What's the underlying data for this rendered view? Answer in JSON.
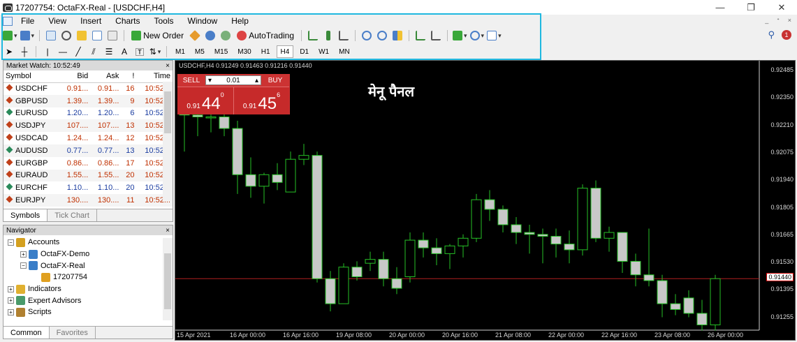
{
  "window": {
    "title": "17207754: OctaFX-Real - [USDCHF,H4]",
    "controls": [
      "—",
      "❐",
      "✕"
    ]
  },
  "menu": [
    "File",
    "View",
    "Insert",
    "Charts",
    "Tools",
    "Window",
    "Help"
  ],
  "mdi_controls": [
    "_",
    "ᐩ",
    "×"
  ],
  "toolbar": {
    "new_order": "New Order",
    "autotrading": "AutoTrading"
  },
  "timeframes": [
    "M1",
    "M5",
    "M15",
    "M30",
    "H1",
    "H4",
    "D1",
    "W1",
    "MN"
  ],
  "active_timeframe": "H4",
  "text_tool": "A",
  "market_watch": {
    "title": "Market Watch: 10:52:49",
    "close": "×",
    "columns": [
      "Symbol",
      "Bid",
      "Ask",
      "!",
      "Time"
    ],
    "rows": [
      {
        "symbol": "USDCHF",
        "bid": "0.91...",
        "ask": "0.91...",
        "spread": "16",
        "time": "10:52...",
        "dir": "down"
      },
      {
        "symbol": "GBPUSD",
        "bid": "1.39...",
        "ask": "1.39...",
        "spread": "9",
        "time": "10:52...",
        "dir": "down"
      },
      {
        "symbol": "EURUSD",
        "bid": "1.20...",
        "ask": "1.20...",
        "spread": "6",
        "time": "10:52...",
        "dir": "up"
      },
      {
        "symbol": "USDJPY",
        "bid": "107....",
        "ask": "107....",
        "spread": "13",
        "time": "10:52...",
        "dir": "down"
      },
      {
        "symbol": "USDCAD",
        "bid": "1.24...",
        "ask": "1.24...",
        "spread": "12",
        "time": "10:52...",
        "dir": "down"
      },
      {
        "symbol": "AUDUSD",
        "bid": "0.77...",
        "ask": "0.77...",
        "spread": "13",
        "time": "10:52...",
        "dir": "up"
      },
      {
        "symbol": "EURGBP",
        "bid": "0.86...",
        "ask": "0.86...",
        "spread": "17",
        "time": "10:52...",
        "dir": "down"
      },
      {
        "symbol": "EURAUD",
        "bid": "1.55...",
        "ask": "1.55...",
        "spread": "20",
        "time": "10:52...",
        "dir": "down"
      },
      {
        "symbol": "EURCHF",
        "bid": "1.10...",
        "ask": "1.10...",
        "spread": "20",
        "time": "10:52...",
        "dir": "up"
      },
      {
        "symbol": "EURJPY",
        "bid": "130....",
        "ask": "130....",
        "spread": "11",
        "time": "10:52...",
        "dir": "down"
      }
    ],
    "tabs": [
      "Symbols",
      "Tick Chart"
    ]
  },
  "navigator": {
    "title": "Navigator",
    "close": "×",
    "items": [
      {
        "label": "Accounts",
        "level": 0,
        "exp": "−"
      },
      {
        "label": "OctaFX-Demo",
        "level": 1,
        "exp": "+"
      },
      {
        "label": "OctaFX-Real",
        "level": 1,
        "exp": "−"
      },
      {
        "label": "17207754",
        "level": 2,
        "exp": ""
      },
      {
        "label": "Indicators",
        "level": 0,
        "exp": "+"
      },
      {
        "label": "Expert Advisors",
        "level": 0,
        "exp": "+"
      },
      {
        "label": "Scripts",
        "level": 0,
        "exp": "+"
      }
    ],
    "tabs": [
      "Common",
      "Favorites"
    ]
  },
  "chart": {
    "header": "USDCHF,H4  0.91249 0.91463 0.91216 0.91440",
    "annotation": "मेनू पैनल",
    "trade": {
      "sell": "SELL",
      "buy": "BUY",
      "lot": "0.01",
      "sell_small": "0.91",
      "sell_big": "44",
      "sell_sup": "0",
      "buy_small": "0.91",
      "buy_big": "45",
      "buy_sup": "6"
    },
    "price_labels": [
      "0.92485",
      "0.92350",
      "0.92210",
      "0.92075",
      "0.91940",
      "0.91805",
      "0.91665",
      "0.91530",
      "0.91395",
      "0.91255"
    ],
    "current_price": "0.91440",
    "time_labels": [
      "15 Apr 2021",
      "16 Apr 00:00",
      "16 Apr 16:00",
      "19 Apr 08:00",
      "20 Apr 00:00",
      "20 Apr 16:00",
      "21 Apr 08:00",
      "22 Apr 00:00",
      "22 Apr 16:00",
      "23 Apr 08:00",
      "26 Apr 00:00"
    ]
  },
  "chart_data": {
    "type": "candlestick",
    "title": "USDCHF,H4",
    "ylim": [
      0.9118,
      0.9255
    ],
    "candles": [
      {
        "o": 0.9232,
        "h": 0.9248,
        "l": 0.921,
        "c": 0.9229
      },
      {
        "o": 0.9229,
        "h": 0.9236,
        "l": 0.9218,
        "c": 0.9228
      },
      {
        "o": 0.9228,
        "h": 0.9234,
        "l": 0.922,
        "c": 0.9228
      },
      {
        "o": 0.9228,
        "h": 0.9234,
        "l": 0.9218,
        "c": 0.9222
      },
      {
        "o": 0.9222,
        "h": 0.9226,
        "l": 0.9188,
        "c": 0.9198
      },
      {
        "o": 0.9198,
        "h": 0.9207,
        "l": 0.9186,
        "c": 0.9192
      },
      {
        "o": 0.9192,
        "h": 0.9199,
        "l": 0.9183,
        "c": 0.9198
      },
      {
        "o": 0.9198,
        "h": 0.9204,
        "l": 0.919,
        "c": 0.9194
      },
      {
        "o": 0.9189,
        "h": 0.921,
        "l": 0.9189,
        "c": 0.9206
      },
      {
        "o": 0.9206,
        "h": 0.9214,
        "l": 0.9203,
        "c": 0.9208
      },
      {
        "o": 0.9208,
        "h": 0.921,
        "l": 0.9142,
        "c": 0.9144
      },
      {
        "o": 0.9144,
        "h": 0.9148,
        "l": 0.9127,
        "c": 0.9131
      },
      {
        "o": 0.9131,
        "h": 0.9152,
        "l": 0.9131,
        "c": 0.915
      },
      {
        "o": 0.915,
        "h": 0.9153,
        "l": 0.9143,
        "c": 0.9145
      },
      {
        "o": 0.9152,
        "h": 0.9158,
        "l": 0.9148,
        "c": 0.9154
      },
      {
        "o": 0.9154,
        "h": 0.9158,
        "l": 0.914,
        "c": 0.9144
      },
      {
        "o": 0.9144,
        "h": 0.915,
        "l": 0.9136,
        "c": 0.9139
      },
      {
        "o": 0.9145,
        "h": 0.9168,
        "l": 0.9142,
        "c": 0.9164
      },
      {
        "o": 0.9164,
        "h": 0.9168,
        "l": 0.9155,
        "c": 0.916
      },
      {
        "o": 0.916,
        "h": 0.9165,
        "l": 0.9151,
        "c": 0.9157
      },
      {
        "o": 0.9157,
        "h": 0.9162,
        "l": 0.9149,
        "c": 0.9161
      },
      {
        "o": 0.9161,
        "h": 0.9167,
        "l": 0.9155,
        "c": 0.9165
      },
      {
        "o": 0.9165,
        "h": 0.9188,
        "l": 0.9163,
        "c": 0.9185
      },
      {
        "o": 0.9185,
        "h": 0.919,
        "l": 0.9174,
        "c": 0.918
      },
      {
        "o": 0.918,
        "h": 0.9182,
        "l": 0.9168,
        "c": 0.9172
      },
      {
        "o": 0.9172,
        "h": 0.9176,
        "l": 0.9162,
        "c": 0.9168
      },
      {
        "o": 0.9168,
        "h": 0.9172,
        "l": 0.9157,
        "c": 0.9167
      },
      {
        "o": 0.9167,
        "h": 0.917,
        "l": 0.9152,
        "c": 0.9166
      },
      {
        "o": 0.9166,
        "h": 0.917,
        "l": 0.9155,
        "c": 0.9162
      },
      {
        "o": 0.9162,
        "h": 0.9169,
        "l": 0.9152,
        "c": 0.9159
      },
      {
        "o": 0.9159,
        "h": 0.9193,
        "l": 0.9156,
        "c": 0.9191
      },
      {
        "o": 0.9191,
        "h": 0.9195,
        "l": 0.9163,
        "c": 0.9165
      },
      {
        "o": 0.9165,
        "h": 0.9171,
        "l": 0.9158,
        "c": 0.9168
      },
      {
        "o": 0.9168,
        "h": 0.9168,
        "l": 0.9147,
        "c": 0.9153
      },
      {
        "o": 0.9153,
        "h": 0.9157,
        "l": 0.914,
        "c": 0.9146
      },
      {
        "o": 0.9146,
        "h": 0.917,
        "l": 0.914,
        "c": 0.9143
      },
      {
        "o": 0.9143,
        "h": 0.9146,
        "l": 0.9124,
        "c": 0.9131
      },
      {
        "o": 0.9131,
        "h": 0.9136,
        "l": 0.9125,
        "c": 0.9128
      },
      {
        "o": 0.9134,
        "h": 0.9138,
        "l": 0.9124,
        "c": 0.9126
      },
      {
        "o": 0.9126,
        "h": 0.9133,
        "l": 0.9117,
        "c": 0.912
      },
      {
        "o": 0.912,
        "h": 0.9146,
        "l": 0.9117,
        "c": 0.9144
      }
    ]
  }
}
